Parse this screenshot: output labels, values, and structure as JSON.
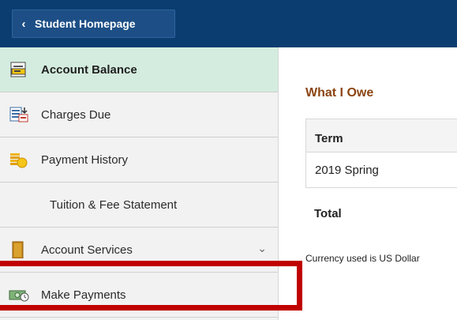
{
  "header": {
    "back_label": "Student Homepage"
  },
  "sidebar": {
    "items": [
      {
        "label": "Account Balance",
        "icon": "account-balance-icon",
        "active": true
      },
      {
        "label": "Charges Due",
        "icon": "charges-due-icon"
      },
      {
        "label": "Payment History",
        "icon": "payment-history-icon"
      },
      {
        "label": "Tuition & Fee Statement"
      },
      {
        "label": "Account Services",
        "icon": "account-services-icon",
        "expandable": true
      },
      {
        "label": "Make Payments",
        "icon": "make-payments-icon"
      }
    ]
  },
  "main": {
    "section_title": "What I Owe",
    "table": {
      "header": "Term",
      "rows": [
        "2019 Spring"
      ]
    },
    "total_label": "Total",
    "currency_note": "Currency used is US Dollar"
  },
  "colors": {
    "header_bg": "#0b3d70",
    "active_bg": "#d4ecdf",
    "section_title": "#8b4513",
    "highlight": "#c00000"
  }
}
